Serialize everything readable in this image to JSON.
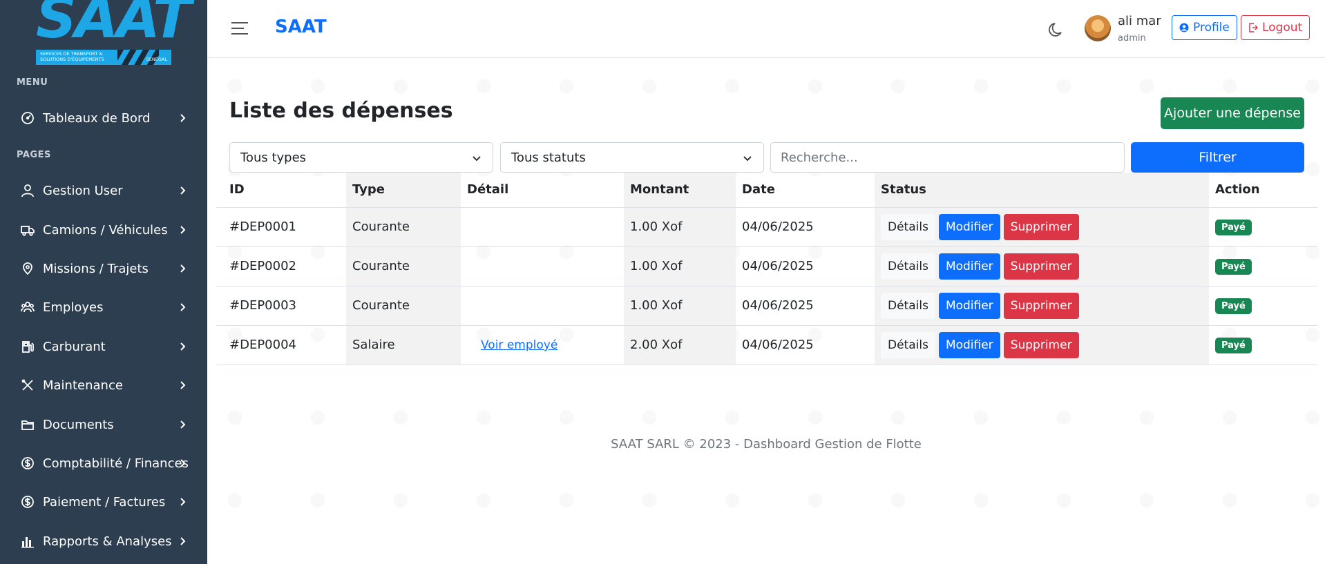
{
  "sidebar": {
    "logo": {
      "word": "SAAT",
      "tagline": "Services de transport & solutions d'équipements",
      "country": "Senegal"
    },
    "menu_label": "MENU",
    "pages_label": "PAGES",
    "items": [
      {
        "label": "Tableaux de Bord",
        "icon": "dashboard-icon"
      },
      {
        "label": "Gestion User",
        "icon": "user-icon"
      },
      {
        "label": "Camions / Véhicules",
        "icon": "truck-icon"
      },
      {
        "label": "Missions / Trajets",
        "icon": "map-pin-icon"
      },
      {
        "label": "Employes",
        "icon": "people-icon"
      },
      {
        "label": "Carburant",
        "icon": "fuel-icon"
      },
      {
        "label": "Maintenance",
        "icon": "tools-icon"
      },
      {
        "label": "Documents",
        "icon": "folder-icon"
      },
      {
        "label": "Comptabilité / Finances",
        "icon": "dollar-circle-icon"
      },
      {
        "label": "Paiement / Factures",
        "icon": "dollar-circle-icon"
      },
      {
        "label": "Rapports & Analyses",
        "icon": "bar-chart-icon"
      }
    ]
  },
  "header": {
    "brand": "SAAT",
    "user_name": "ali mar",
    "user_role": "admin",
    "profile_label": "Profile",
    "logout_label": "Logout"
  },
  "main": {
    "title": "Liste des dépenses",
    "add_button": "Ajouter une dépense",
    "filters": {
      "type_selected": "Tous types",
      "status_selected": "Tous statuts",
      "search_placeholder": "Recherche...",
      "filter_button": "Filtrer"
    },
    "table": {
      "headers": [
        "ID",
        "Type",
        "Détail",
        "Montant",
        "Date",
        "Status",
        "Action"
      ],
      "rows": [
        {
          "id": "#DEP0001",
          "type": "Courante",
          "detail": "",
          "montant": "1.00 Xof",
          "date": "04/06/2025",
          "status": "Payé"
        },
        {
          "id": "#DEP0002",
          "type": "Courante",
          "detail": "",
          "montant": "1.00 Xof",
          "date": "04/06/2025",
          "status": "Payé"
        },
        {
          "id": "#DEP0003",
          "type": "Courante",
          "detail": "",
          "montant": "1.00 Xof",
          "date": "04/06/2025",
          "status": "Payé"
        },
        {
          "id": "#DEP0004",
          "type": "Salaire",
          "detail": "Voir employé",
          "montant": "2.00 Xof",
          "date": "04/06/2025",
          "status": "Payé"
        }
      ],
      "row_buttons": {
        "details": "Détails",
        "modifier": "Modifier",
        "supprimer": "Supprimer"
      }
    },
    "footer": "SAAT SARL © 2023 - Dashboard Gestion de Flotte"
  },
  "colors": {
    "sidebar_bg": "#2c3e50",
    "primary": "#0d6efd",
    "success": "#198754",
    "danger": "#dc3545",
    "logo_blue": "#1ea7e6"
  }
}
